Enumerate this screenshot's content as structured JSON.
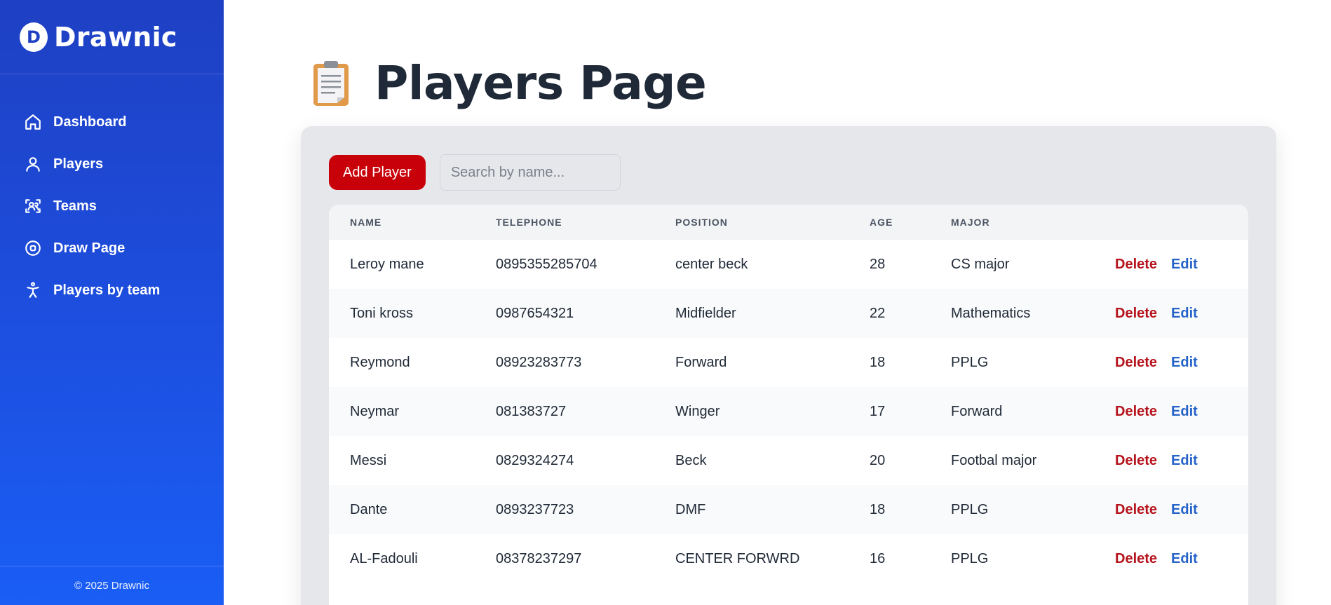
{
  "app": {
    "name": "Drawnic",
    "logo_letter": "D"
  },
  "sidebar": {
    "items": [
      {
        "label": "Dashboard",
        "icon": "home-icon"
      },
      {
        "label": "Players",
        "icon": "user-icon"
      },
      {
        "label": "Teams",
        "icon": "scan-users-icon"
      },
      {
        "label": "Draw Page",
        "icon": "circle-target-icon"
      },
      {
        "label": "Players by team",
        "icon": "person-arms-icon"
      }
    ],
    "footer": "© 2025 Drawnic"
  },
  "page": {
    "title": "Players Page",
    "title_icon": "clipboard-icon"
  },
  "toolbar": {
    "add_label": "Add Player",
    "search_placeholder": "Search by name..."
  },
  "table": {
    "headers": {
      "name": "NAME",
      "telephone": "TELEPHONE",
      "position": "POSITION",
      "age": "AGE",
      "major": "MAJOR"
    },
    "delete_label": "Delete",
    "edit_label": "Edit",
    "rows": [
      {
        "name": "Leroy mane",
        "telephone": "0895355285704",
        "position": "center beck",
        "age": "28",
        "major": "CS major"
      },
      {
        "name": "Toni kross",
        "telephone": "0987654321",
        "position": "Midfielder",
        "age": "22",
        "major": "Mathematics"
      },
      {
        "name": "Reymond",
        "telephone": "08923283773",
        "position": "Forward",
        "age": "18",
        "major": "PPLG"
      },
      {
        "name": "Neymar",
        "telephone": "081383727",
        "position": "Winger",
        "age": "17",
        "major": "Forward"
      },
      {
        "name": "Messi",
        "telephone": "0829324274",
        "position": "Beck",
        "age": "20",
        "major": "Footbal major"
      },
      {
        "name": "Dante",
        "telephone": "0893237723",
        "position": "DMF",
        "age": "18",
        "major": "PPLG"
      },
      {
        "name": "AL-Fadouli",
        "telephone": "08378237297",
        "position": "CENTER FORWRD",
        "age": "16",
        "major": "PPLG"
      }
    ]
  },
  "colors": {
    "sidebar_top": "#1e40c3",
    "sidebar_bottom": "#1a5ef5",
    "add_button": "#c8000a",
    "delete": "#b5121b",
    "edit": "#2563c9"
  }
}
